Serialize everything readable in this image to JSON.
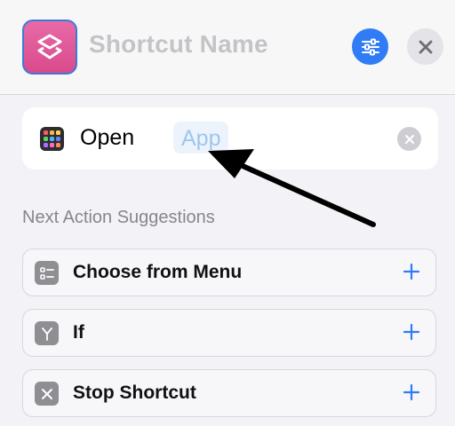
{
  "header": {
    "title_placeholder": "Shortcut Name",
    "icon": "shortcuts-layers-icon",
    "settings_icon": "sliders-icon",
    "close_icon": "close-icon"
  },
  "action_card": {
    "icon": "app-grid-icon",
    "verb": "Open",
    "parameter": "App",
    "clear_icon": "clear-x-icon"
  },
  "suggestions": {
    "title": "Next Action Suggestions",
    "items": [
      {
        "label": "Choose from Menu",
        "icon": "menu-list-icon"
      },
      {
        "label": "If",
        "icon": "branch-icon"
      },
      {
        "label": "Stop Shortcut",
        "icon": "stop-x-icon"
      }
    ],
    "add_icon": "plus-icon"
  },
  "colors": {
    "accent": "#2f7cf6",
    "shortcut_icon": "#d94a8d",
    "background": "#f2f2f7",
    "placeholder": "#c4c4c8"
  }
}
